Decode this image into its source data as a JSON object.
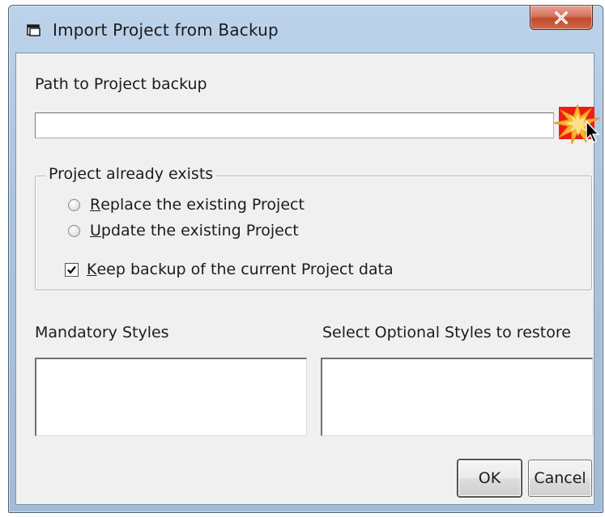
{
  "window": {
    "title": "Import Project from Backup",
    "close_label": "X",
    "icon": "dialog-window-icon"
  },
  "path": {
    "label": "Path to Project backup",
    "value": "",
    "browse_icon": "browse-folder-icon"
  },
  "group": {
    "legend": "Project already exists",
    "options": [
      {
        "prefix": "",
        "accel": "R",
        "rest": "eplace the existing Project",
        "selected": false
      },
      {
        "prefix": "",
        "accel": "U",
        "rest": "pdate the existing Project",
        "selected": false
      }
    ],
    "keep_backup": {
      "prefix": "",
      "accel": "K",
      "rest": "eep backup of the current Project data",
      "checked": true
    }
  },
  "styles": {
    "mandatory_label": "Mandatory Styles",
    "optional_label": "Select Optional Styles to restore"
  },
  "buttons": {
    "ok": "OK",
    "cancel": "Cancel"
  },
  "colors": {
    "highlight": "#f01c14",
    "titlebar": "#b3cbe4",
    "close_button": "#c8553b"
  }
}
